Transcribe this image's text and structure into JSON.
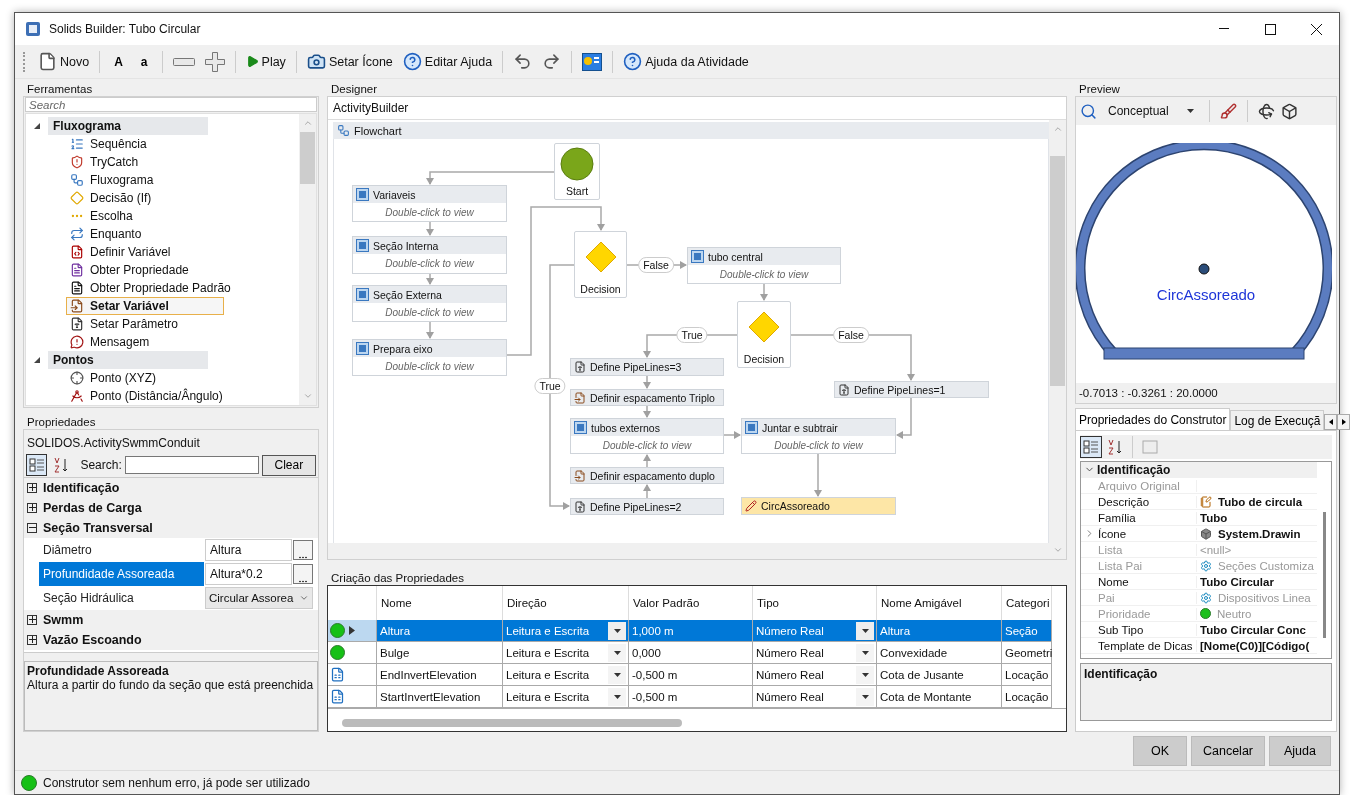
{
  "window": {
    "title": "Solids Builder: Tubo Circular"
  },
  "toolbar": [
    {
      "kind": "new",
      "label": "Novo"
    },
    {
      "kind": "separator"
    },
    {
      "kind": "letter",
      "label": "A"
    },
    {
      "kind": "letter",
      "label": "a"
    },
    {
      "kind": "separator"
    },
    {
      "kind": "minus"
    },
    {
      "kind": "plus"
    },
    {
      "kind": "separator"
    },
    {
      "kind": "play",
      "label": "Play"
    },
    {
      "kind": "separator"
    },
    {
      "kind": "camera",
      "label": "Setar Ícone"
    },
    {
      "kind": "help-edit",
      "label": "Editar Ajuda"
    },
    {
      "kind": "separator"
    },
    {
      "kind": "undo"
    },
    {
      "kind": "redo"
    },
    {
      "kind": "separator"
    },
    {
      "kind": "image"
    },
    {
      "kind": "separator"
    },
    {
      "kind": "help",
      "label": "Ajuda da Atividade"
    }
  ],
  "tools": {
    "title": "Ferramentas",
    "search": {
      "placeholder": "Search"
    },
    "groups": [
      {
        "label": "Fluxograma",
        "expanded": true,
        "children": [
          {
            "kind": "sequence",
            "label": "Sequência",
            "selected": false
          },
          {
            "kind": "trycatch",
            "label": "TryCatch",
            "selected": false
          },
          {
            "kind": "flowchart",
            "label": "Fluxograma",
            "selected": false
          },
          {
            "kind": "decision",
            "label": "Decisão (If)",
            "selected": false
          },
          {
            "kind": "choice",
            "label": "Escolha",
            "selected": false
          },
          {
            "kind": "while",
            "label": "Enquanto",
            "selected": false
          },
          {
            "kind": "define-var",
            "label": "Definir Variável",
            "selected": false
          },
          {
            "kind": "get-prop",
            "label": "Obter Propriedade",
            "selected": false
          },
          {
            "kind": "get-default",
            "label": "Obter Propriedade Padrão",
            "selected": false
          },
          {
            "kind": "set-var",
            "label": "Setar Variável",
            "selected": true
          },
          {
            "kind": "set-param",
            "label": "Setar Parâmetro",
            "selected": false
          },
          {
            "kind": "message",
            "label": "Mensagem",
            "selected": false
          }
        ]
      },
      {
        "label": "Pontos",
        "expanded": true,
        "children": [
          {
            "kind": "point",
            "label": "Ponto (XYZ)",
            "selected": false
          },
          {
            "kind": "angle",
            "label": "Ponto (Distância/Ângulo)",
            "selected": false
          }
        ]
      }
    ]
  },
  "properties": {
    "title": "Propriedades",
    "object": "SOLIDOS.ActivitySwmmConduit",
    "search_label": "Search:",
    "clear_button": "Clear",
    "categories": [
      {
        "label": "Identificação",
        "expanded": false
      },
      {
        "label": "Perdas de Carga",
        "expanded": false
      },
      {
        "label": "Seção Transversal",
        "expanded": true,
        "children": [
          {
            "kind": "ellipsis",
            "name": "Diâmetro",
            "value": "Altura",
            "selected": false
          },
          {
            "kind": "ellipsis",
            "name": "Profundidade Assoreada",
            "value": "Altura*0.2",
            "selected": true
          },
          {
            "kind": "dropdown",
            "name": "Seção Hidráulica",
            "value": "Circular Assorea",
            "selected": false
          }
        ]
      },
      {
        "label": "Swmm",
        "expanded": false
      },
      {
        "label": "Vazão Escoando",
        "expanded": false
      }
    ],
    "description": {
      "title": "Profundidade Assoreada",
      "text": "Altura a partir do fundo da seção que está preenchida"
    }
  },
  "designer": {
    "title": "Designer",
    "breadcrumb": "ActivityBuilder",
    "flowchart": {
      "title": "Flowchart",
      "nodes": [
        {
          "kind": "start",
          "label": "Start"
        },
        {
          "kind": "sequence",
          "label": "Variaveis",
          "subtitle": "Double-click to view"
        },
        {
          "kind": "sequence",
          "label": "Seção Interna",
          "subtitle": "Double-click to view"
        },
        {
          "kind": "sequence",
          "label": "Seção Externa",
          "subtitle": "Double-click to view"
        },
        {
          "kind": "sequence",
          "label": "Prepara eixo",
          "subtitle": "Double-click to view"
        },
        {
          "kind": "decision",
          "label": "Decision"
        },
        {
          "kind": "sequence",
          "label": "tubo central",
          "subtitle": "Double-click to view"
        },
        {
          "kind": "decision",
          "label": "Decision"
        },
        {
          "kind": "param-step",
          "label": "Define PipeLines=3"
        },
        {
          "kind": "setvar-step",
          "label": "Definir espacamento Triplo"
        },
        {
          "kind": "sequence",
          "label": "tubos externos",
          "subtitle": "Double-click to view"
        },
        {
          "kind": "setvar-step",
          "label": "Definir espacamento duplo"
        },
        {
          "kind": "param-step",
          "label": "Define PipeLines=2"
        },
        {
          "kind": "param-step",
          "label": "Define PipeLines=1"
        },
        {
          "kind": "sequence",
          "label": "Juntar e subtrair",
          "subtitle": "Double-click to view"
        },
        {
          "kind": "output",
          "label": "CircAssoreado"
        }
      ],
      "edge_labels": [
        "False",
        "True",
        "True",
        "False"
      ]
    }
  },
  "property_grid": {
    "title": "Criação das Propriedades",
    "columns": [
      "Nome",
      "Direção",
      "Valor Padrão",
      "Tipo",
      "Nome Amigável",
      "Categori"
    ],
    "rows": [
      {
        "kind": "ok",
        "selected": true,
        "cells": [
          "Altura",
          "Leitura e Escrita",
          "1,000 m",
          "Número Real",
          "Altura",
          "Seção"
        ]
      },
      {
        "kind": "ok",
        "selected": false,
        "cells": [
          "Bulge",
          "Leitura e Escrita",
          "0,000",
          "Número Real",
          "Convexidade",
          "Geometri"
        ]
      },
      {
        "kind": "sheet",
        "selected": false,
        "cells": [
          "EndInvertElevation",
          "Leitura e Escrita",
          "-0,500 m",
          "Número Real",
          "Cota de Jusante",
          "Locação"
        ]
      },
      {
        "kind": "sheet",
        "selected": false,
        "cells": [
          "StartInvertElevation",
          "Leitura e Escrita",
          "-0,500 m",
          "Número Real",
          "Cota de Montante",
          "Locação"
        ]
      }
    ]
  },
  "preview": {
    "title": "Preview",
    "view_mode": "Conceptual",
    "shape_label": "CircAssoreado",
    "coordinates": "-0.7013 : -0.3261 : 20.0000"
  },
  "builder_panel": {
    "tabs": [
      {
        "label": "Propriedades do Construtor",
        "selected": true
      },
      {
        "label": "Log de Execuçã",
        "selected": false
      }
    ],
    "category": {
      "label": "Identificação",
      "expanded": true
    },
    "rows": [
      {
        "kind": "text",
        "name": "Arquivo Original",
        "disabled": true,
        "expandable": false
      },
      {
        "kind": "note",
        "name": "Descrição",
        "value": "Tubo de circula",
        "disabled": false,
        "expandable": false
      },
      {
        "kind": "text",
        "name": "Família",
        "value": "Tubo",
        "disabled": false,
        "expandable": false
      },
      {
        "kind": "cube",
        "name": "Ícone",
        "value": "System.Drawin",
        "expandable": true,
        "disabled": false
      },
      {
        "kind": "text",
        "name": "Lista",
        "value": "<null>",
        "disabled": true,
        "expandable": false
      },
      {
        "kind": "gear",
        "name": "Lista Pai",
        "value": "Seções Customiza",
        "disabled": true,
        "expandable": false
      },
      {
        "kind": "text",
        "name": "Nome",
        "value": "Tubo Circular",
        "disabled": false,
        "expandable": false
      },
      {
        "kind": "gear",
        "name": "Pai",
        "value": "Dispositivos Linea",
        "disabled": true,
        "expandable": false
      },
      {
        "kind": "dot",
        "name": "Prioridade",
        "value": "Neutro",
        "disabled": true,
        "expandable": false
      },
      {
        "kind": "text",
        "name": "Sub Tipo",
        "value": "Tubo Circular Conc",
        "disabled": false,
        "expandable": false
      },
      {
        "kind": "text",
        "name": "Template de Dicas",
        "value": "[Nome(C0)][Código(",
        "disabled": false,
        "expandable": false
      }
    ],
    "description": "Identificação"
  },
  "buttons": [
    "OK",
    "Cancelar",
    "Ajuda"
  ],
  "status": {
    "ok": true,
    "text": "Construtor sem nenhum erro, já pode ser utilizado"
  }
}
